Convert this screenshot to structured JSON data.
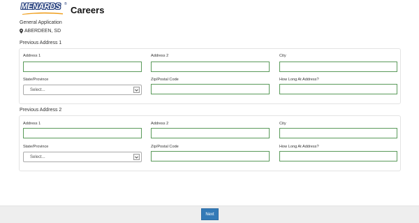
{
  "header": {
    "logo_text": "MENARDS",
    "logo_reg": "®",
    "title": "Careers"
  },
  "application": {
    "title": "General Application",
    "location": "ABERDEEN, SD"
  },
  "sections": [
    {
      "title": "Previous Address 1",
      "address1_label": "Address 1",
      "address1_value": "",
      "address2_label": "Address 2",
      "address2_value": "",
      "city_label": "City",
      "city_value": "",
      "state_label": "State/Province",
      "state_value": "Select...",
      "zip_label": "Zip/Postal Code",
      "zip_value": "",
      "howlong_label": "How Long At Address?",
      "howlong_value": ""
    },
    {
      "title": "Previous Address 2",
      "address1_label": "Address 1",
      "address1_value": "",
      "address2_label": "Address 2",
      "address2_value": "",
      "city_label": "City",
      "city_value": "",
      "state_label": "State/Province",
      "state_value": "Select...",
      "zip_label": "Zip/Postal Code",
      "zip_value": "",
      "howlong_label": "How Long At Address?",
      "howlong_value": ""
    }
  ],
  "footer": {
    "next_label": "Next"
  },
  "colors": {
    "brand_blue": "#1f3a7a",
    "brand_orange": "#f0a020",
    "button_primary": "#337ab7",
    "input_border_valid": "#5a9a5a"
  }
}
